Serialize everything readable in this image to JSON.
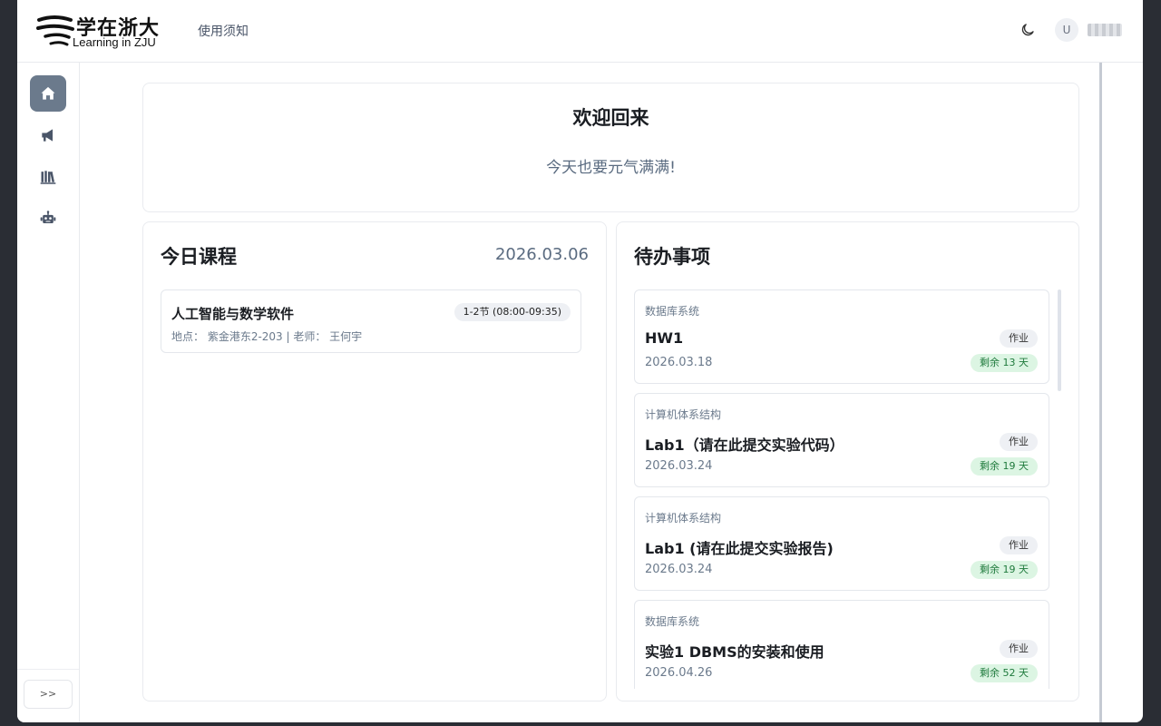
{
  "header": {
    "logo_cn": "学在浙大",
    "logo_en": "Learning in ZJU",
    "nav_link": "使用须知",
    "avatar_initial": "U",
    "username": "████"
  },
  "sidebar": {
    "items": [
      {
        "icon": "home-icon",
        "active": true
      },
      {
        "icon": "megaphone-icon",
        "active": false
      },
      {
        "icon": "books-icon",
        "active": false
      },
      {
        "icon": "robot-icon",
        "active": false
      }
    ],
    "expand_label": ">>"
  },
  "welcome": {
    "title": "欢迎回来",
    "subtitle": "今天也要元气满满!"
  },
  "courses": {
    "title": "今日课程",
    "date": "2026.03.06",
    "items": [
      {
        "name": "人工智能与数学软件",
        "time": "1-2节 (08:00-09:35)",
        "meta": "地点： 紫金港东2-203 | 老师： 王何宇"
      }
    ]
  },
  "todos": {
    "title": "待办事项",
    "items": [
      {
        "course": "数据库系统",
        "title": "HW1",
        "date": "2026.03.18",
        "type": "作业",
        "remaining": "剩余 13 天"
      },
      {
        "course": "计算机体系结构",
        "title": "Lab1（请在此提交实验代码）",
        "date": "2026.03.24",
        "type": "作业",
        "remaining": "剩余 19 天"
      },
      {
        "course": "计算机体系结构",
        "title": "Lab1 (请在此提交实验报告)",
        "date": "2026.03.24",
        "type": "作业",
        "remaining": "剩余 19 天"
      },
      {
        "course": "数据库系统",
        "title": "实验1  DBMS的安装和使用",
        "date": "2026.04.26",
        "type": "作业",
        "remaining": "剩余 52 天"
      }
    ]
  },
  "colors": {
    "accent_active": "#6b7a8c",
    "remaining_bg": "#dcf5e3",
    "remaining_text": "#1f7a3c"
  }
}
